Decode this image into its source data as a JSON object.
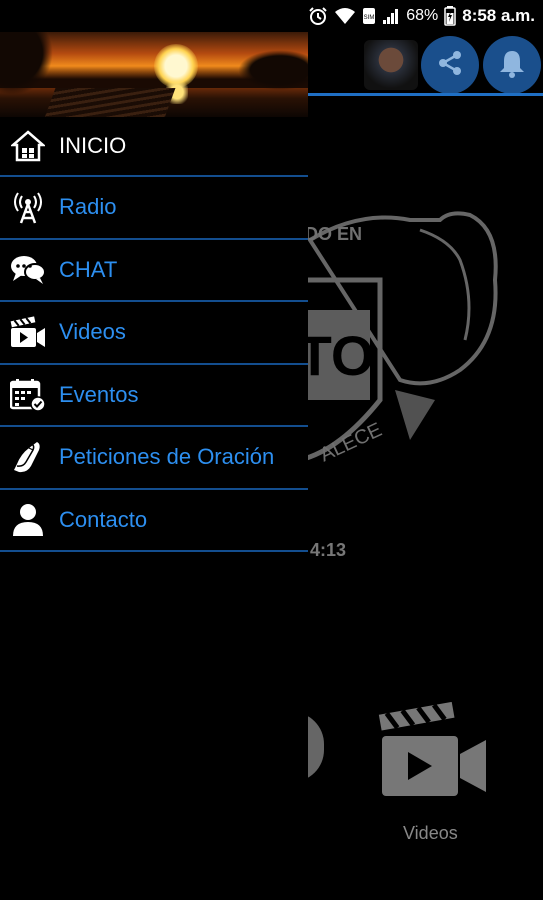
{
  "status_bar": {
    "battery_percent": "68%",
    "time": "8:58 a.m.",
    "icons": [
      "alarm-icon",
      "wifi-icon",
      "sim-icon",
      "signal-icon",
      "battery-icon"
    ],
    "sim_label": "SIM"
  },
  "colors": {
    "accent_blue": "#2d8ff0",
    "divider": "#134e8f",
    "round_button": "#1a4f8c"
  },
  "drawer": {
    "items": [
      {
        "label": "INICIO",
        "icon": "home-icon"
      },
      {
        "label": "Radio",
        "icon": "radio-tower-icon"
      },
      {
        "label": "CHAT",
        "icon": "chat-bubbles-icon"
      },
      {
        "label": "Videos",
        "icon": "video-clapper-icon"
      },
      {
        "label": "Eventos",
        "icon": "calendar-icon"
      },
      {
        "label": "Peticiones de Oración",
        "icon": "praying-hands-icon"
      },
      {
        "label": "Contacto",
        "icon": "person-icon"
      }
    ]
  },
  "background": {
    "logo_text_top": "DO EN",
    "logo_text_mid": "TO",
    "logo_text_bottom": "ALECE",
    "time_fragment": "4:13",
    "videos_label": "Videos"
  }
}
